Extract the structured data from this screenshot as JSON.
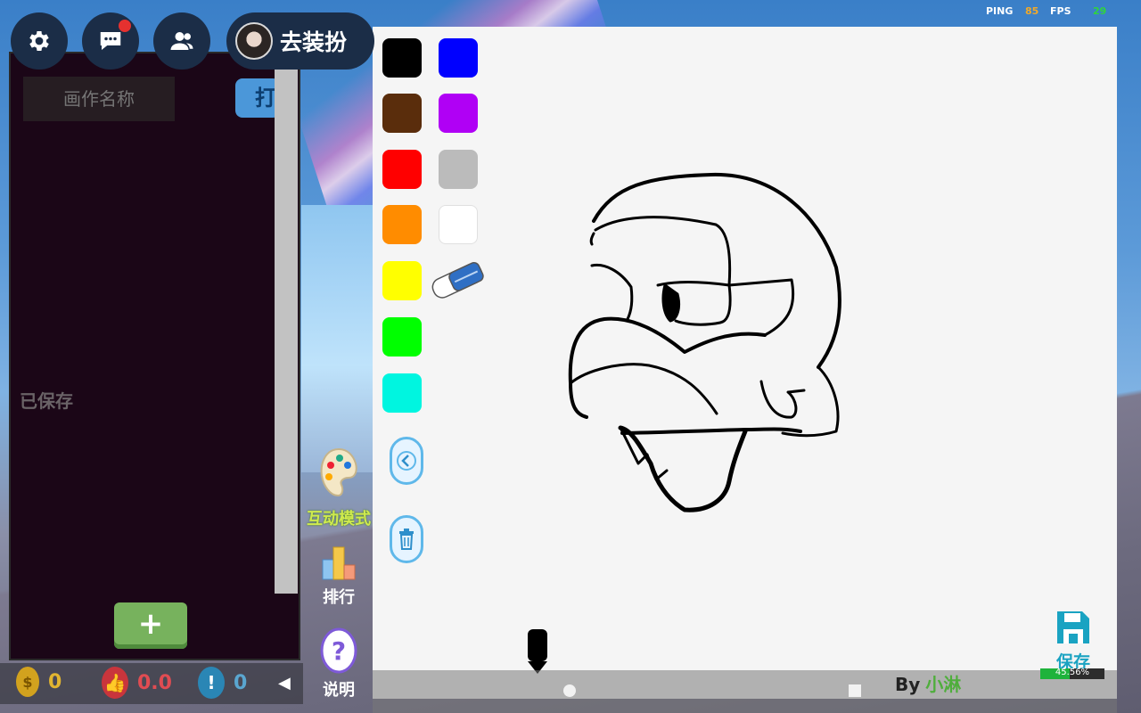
{
  "hud": {
    "ping_label": "PING",
    "ping_value": "85",
    "fps_label": "FPS",
    "fps_value": "29"
  },
  "top_buttons": {
    "dress_label": "去装扮"
  },
  "left_panel": {
    "name_placeholder": "画作名称",
    "open_label": "打",
    "saved_label": "已保存",
    "add_label": "+"
  },
  "stats": {
    "coins": "0",
    "likes": "0.0",
    "reports": "0"
  },
  "side_tools": {
    "interactive_mode": "互动模式",
    "ranking": "排行",
    "help": "说明"
  },
  "palette": [
    "#000000",
    "#0000ff",
    "#5a2d0c",
    "#b000f5",
    "#ff0000",
    "#bbbbbb",
    "#ff8c00",
    "#ffffff",
    "#ffff00",
    "#00ff00",
    "#00f5e0"
  ],
  "canvas": {
    "save_label": "保存",
    "progress_text": "45.56%",
    "progress": 0.4556,
    "byline_prefix": "By",
    "byline_author": "小淋"
  }
}
